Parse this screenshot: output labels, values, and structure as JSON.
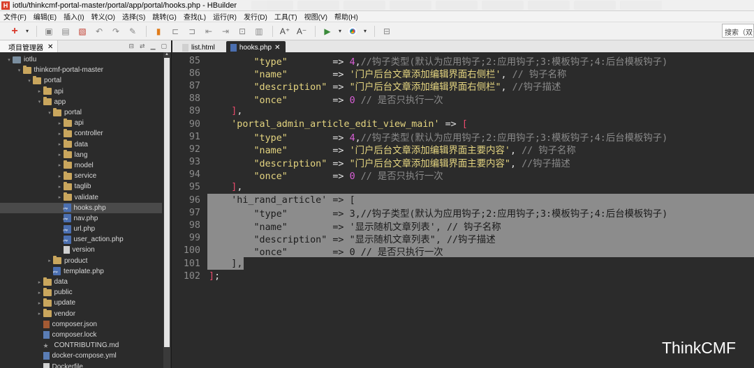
{
  "window": {
    "title": "iotlu/thinkcmf-portal-master/portal/app/portal/hooks.php  -  HBuilder",
    "app_icon_letter": "H"
  },
  "menu": [
    "文件(F)",
    "编辑(E)",
    "插入(I)",
    "转义(O)",
    "选择(S)",
    "跳转(G)",
    "查找(L)",
    "运行(R)",
    "发行(D)",
    "工具(T)",
    "视图(V)",
    "帮助(H)"
  ],
  "toolbar": {
    "search_placeholder": "搜索（双击"
  },
  "sidebar": {
    "tab_label": "项目管理器",
    "close_glyph": "✕",
    "tree": [
      {
        "label": "iotlu",
        "depth": 0,
        "type": "project",
        "twisty": "▾"
      },
      {
        "label": "thinkcmf-portal-master",
        "depth": 1,
        "type": "folder",
        "twisty": "▾"
      },
      {
        "label": "portal",
        "depth": 2,
        "type": "folder",
        "twisty": "▾"
      },
      {
        "label": "api",
        "depth": 3,
        "type": "folder",
        "twisty": "▸"
      },
      {
        "label": "app",
        "depth": 3,
        "type": "folder",
        "twisty": "▾"
      },
      {
        "label": "portal",
        "depth": 4,
        "type": "folder",
        "twisty": "▾"
      },
      {
        "label": "api",
        "depth": 5,
        "type": "folder",
        "twisty": "▸"
      },
      {
        "label": "controller",
        "depth": 5,
        "type": "folder",
        "twisty": "▸"
      },
      {
        "label": "data",
        "depth": 5,
        "type": "folder",
        "twisty": "▸"
      },
      {
        "label": "lang",
        "depth": 5,
        "type": "folder",
        "twisty": "▸"
      },
      {
        "label": "model",
        "depth": 5,
        "type": "folder",
        "twisty": "▸"
      },
      {
        "label": "service",
        "depth": 5,
        "type": "folder",
        "twisty": "▸"
      },
      {
        "label": "taglib",
        "depth": 5,
        "type": "folder",
        "twisty": "▸"
      },
      {
        "label": "validate",
        "depth": 5,
        "type": "folder",
        "twisty": "▸"
      },
      {
        "label": "hooks.php",
        "depth": 5,
        "type": "php",
        "twisty": "",
        "selected": true
      },
      {
        "label": "nav.php",
        "depth": 5,
        "type": "php",
        "twisty": ""
      },
      {
        "label": "url.php",
        "depth": 5,
        "type": "php",
        "twisty": ""
      },
      {
        "label": "user_action.php",
        "depth": 5,
        "type": "php",
        "twisty": ""
      },
      {
        "label": "version",
        "depth": 5,
        "type": "file",
        "twisty": ""
      },
      {
        "label": "product",
        "depth": 4,
        "type": "folder",
        "twisty": "▸"
      },
      {
        "label": "template.php",
        "depth": 4,
        "type": "php",
        "twisty": ""
      },
      {
        "label": "data",
        "depth": 3,
        "type": "folder",
        "twisty": "▸"
      },
      {
        "label": "public",
        "depth": 3,
        "type": "folder",
        "twisty": "▸"
      },
      {
        "label": "update",
        "depth": 3,
        "type": "folder",
        "twisty": "▸"
      },
      {
        "label": "vendor",
        "depth": 3,
        "type": "folder",
        "twisty": "▸"
      },
      {
        "label": "composer.json",
        "depth": 3,
        "type": "json",
        "twisty": ""
      },
      {
        "label": "composer.lock",
        "depth": 3,
        "type": "lock",
        "twisty": ""
      },
      {
        "label": "CONTRIBUTING.md",
        "depth": 3,
        "type": "md",
        "twisty": ""
      },
      {
        "label": "docker-compose.yml",
        "depth": 3,
        "type": "yml",
        "twisty": ""
      },
      {
        "label": "Dockerfile",
        "depth": 3,
        "type": "file",
        "twisty": ""
      }
    ]
  },
  "editor": {
    "tabs": [
      {
        "label": "list.html",
        "active": false,
        "close": ""
      },
      {
        "label": "hooks.php",
        "active": true,
        "close": "✕"
      }
    ],
    "lines": [
      {
        "n": "85",
        "hl": false,
        "seg": [
          [
            "s-op",
            "        "
          ],
          [
            "s-str",
            "\"type\""
          ],
          [
            "s-op",
            "        => "
          ],
          [
            "s-num",
            "4"
          ],
          [
            "s-op",
            ","
          ],
          [
            "s-cmt",
            "//钩子类型(默认为应用钩子;2:应用钩子;3:模板钩子;4:后台模板钩子)"
          ]
        ]
      },
      {
        "n": "86",
        "hl": false,
        "seg": [
          [
            "s-op",
            "        "
          ],
          [
            "s-str",
            "\"name\""
          ],
          [
            "s-op",
            "        => "
          ],
          [
            "s-str",
            "'门户后台文章添加编辑界面右侧栏'"
          ],
          [
            "s-op",
            ", "
          ],
          [
            "s-cmt",
            "// 钩子名称"
          ]
        ]
      },
      {
        "n": "87",
        "hl": false,
        "seg": [
          [
            "s-op",
            "        "
          ],
          [
            "s-str",
            "\"description\""
          ],
          [
            "s-op",
            " => "
          ],
          [
            "s-str",
            "\"门户后台文章添加编辑界面右侧栏\""
          ],
          [
            "s-op",
            ", "
          ],
          [
            "s-cmt",
            "//钩子描述"
          ]
        ]
      },
      {
        "n": "88",
        "hl": false,
        "seg": [
          [
            "s-op",
            "        "
          ],
          [
            "s-str",
            "\"once\""
          ],
          [
            "s-op",
            "        => "
          ],
          [
            "s-num",
            "0"
          ],
          [
            "s-op",
            " "
          ],
          [
            "s-cmt",
            "// 是否只执行一次"
          ]
        ]
      },
      {
        "n": "89",
        "hl": false,
        "seg": [
          [
            "s-op",
            "    "
          ],
          [
            "s-brk",
            "]"
          ],
          [
            "s-op",
            ","
          ]
        ]
      },
      {
        "n": "90",
        "hl": false,
        "seg": [
          [
            "s-op",
            "    "
          ],
          [
            "s-str",
            "'portal_admin_article_edit_view_main'"
          ],
          [
            "s-op",
            " => "
          ],
          [
            "s-brk",
            "["
          ]
        ]
      },
      {
        "n": "91",
        "hl": false,
        "seg": [
          [
            "s-op",
            "        "
          ],
          [
            "s-str",
            "\"type\""
          ],
          [
            "s-op",
            "        => "
          ],
          [
            "s-num",
            "4"
          ],
          [
            "s-op",
            ","
          ],
          [
            "s-cmt",
            "//钩子类型(默认为应用钩子;2:应用钩子;3:模板钩子;4:后台模板钩子)"
          ]
        ]
      },
      {
        "n": "92",
        "hl": false,
        "seg": [
          [
            "s-op",
            "        "
          ],
          [
            "s-str",
            "\"name\""
          ],
          [
            "s-op",
            "        => "
          ],
          [
            "s-str",
            "'门户后台文章添加编辑界面主要内容'"
          ],
          [
            "s-op",
            ", "
          ],
          [
            "s-cmt",
            "// 钩子名称"
          ]
        ]
      },
      {
        "n": "93",
        "hl": false,
        "seg": [
          [
            "s-op",
            "        "
          ],
          [
            "s-str",
            "\"description\""
          ],
          [
            "s-op",
            " => "
          ],
          [
            "s-str",
            "\"门户后台文章添加编辑界面主要内容\""
          ],
          [
            "s-op",
            ", "
          ],
          [
            "s-cmt",
            "//钩子描述"
          ]
        ]
      },
      {
        "n": "94",
        "hl": false,
        "seg": [
          [
            "s-op",
            "        "
          ],
          [
            "s-str",
            "\"once\""
          ],
          [
            "s-op",
            "        => "
          ],
          [
            "s-num",
            "0"
          ],
          [
            "s-op",
            " "
          ],
          [
            "s-cmt",
            "// 是否只执行一次"
          ]
        ]
      },
      {
        "n": "95",
        "hl": false,
        "seg": [
          [
            "s-op",
            "    "
          ],
          [
            "s-brk",
            "]"
          ],
          [
            "s-op",
            ","
          ]
        ]
      },
      {
        "n": "96",
        "hl": true,
        "seg": [
          [
            "s-op",
            "    "
          ],
          [
            "s-str",
            "'hi_rand_article'"
          ],
          [
            "s-op",
            " => "
          ],
          [
            "s-brk",
            "["
          ]
        ]
      },
      {
        "n": "97",
        "hl": true,
        "seg": [
          [
            "s-op",
            "        "
          ],
          [
            "s-str",
            "\"type\""
          ],
          [
            "s-op",
            "        => "
          ],
          [
            "s-num",
            "3"
          ],
          [
            "s-op",
            ","
          ],
          [
            "s-cmt",
            "//钩子类型(默认为应用钩子;2:应用钩子;3:模板钩子;4:后台模板钩子)"
          ]
        ]
      },
      {
        "n": "98",
        "hl": true,
        "seg": [
          [
            "s-op",
            "        "
          ],
          [
            "s-str",
            "\"name\""
          ],
          [
            "s-op",
            "        => "
          ],
          [
            "s-str",
            "'显示随机文章列表'"
          ],
          [
            "s-op",
            ", "
          ],
          [
            "s-cmt",
            "// 钩子名称"
          ]
        ]
      },
      {
        "n": "99",
        "hl": true,
        "seg": [
          [
            "s-op",
            "        "
          ],
          [
            "s-str",
            "\"description\""
          ],
          [
            "s-op",
            " => "
          ],
          [
            "s-str",
            "\"显示随机文章列表\""
          ],
          [
            "s-op",
            ", "
          ],
          [
            "s-cmt",
            "//钩子描述"
          ]
        ]
      },
      {
        "n": "100",
        "hl": true,
        "seg": [
          [
            "s-op",
            "        "
          ],
          [
            "s-str",
            "\"once\""
          ],
          [
            "s-op",
            "        => "
          ],
          [
            "s-num",
            "0"
          ],
          [
            "s-op",
            " "
          ],
          [
            "s-cmt",
            "// 是否只执行一次"
          ]
        ]
      },
      {
        "n": "101",
        "hl": true,
        "seg": [
          [
            "s-op",
            "    "
          ],
          [
            "s-brk",
            "]"
          ],
          [
            "s-op",
            ","
          ]
        ]
      },
      {
        "n": "102",
        "hl": false,
        "seg": [
          [
            "s-brk",
            "]"
          ],
          [
            "s-op",
            ";"
          ]
        ]
      }
    ]
  },
  "watermark": "ThinkCMF"
}
